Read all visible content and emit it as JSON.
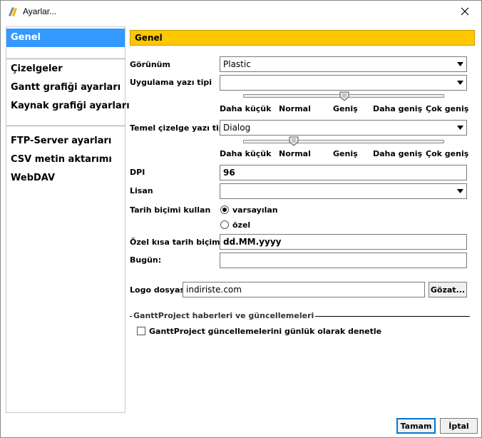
{
  "window": {
    "title": "Ayarlar...",
    "icon": "ganttproject-app-icon",
    "close_icon": "close-icon"
  },
  "nav": {
    "items": [
      {
        "label": "Genel",
        "selected": true
      },
      {
        "label": "Çizelgeler",
        "group": true
      },
      {
        "label": "Gantt grafiği ayarları"
      },
      {
        "label": "Kaynak grafiği ayarları"
      },
      {
        "label": "FTP-Server ayarları"
      },
      {
        "label": "CSV metin aktarımı"
      },
      {
        "label": "WebDAV"
      }
    ]
  },
  "section": {
    "title": "Genel"
  },
  "form": {
    "appearance_label": "Görünüm",
    "appearance_value": "Plastic",
    "app_font_label": "Uygulama yazı tipi",
    "app_font_value": "",
    "app_font_slider_value": "Geniş",
    "chart_font_label": "Temel çizelge yazı tipi",
    "chart_font_value": "Dialog",
    "chart_font_slider_value": "Normal",
    "size_ticks": [
      "Daha küçük",
      "Normal",
      "Geniş",
      "Daha geniş",
      "Çok geniş"
    ],
    "dpi_label": "DPI",
    "dpi_value": "96",
    "language_label": "Lisan",
    "language_value": "",
    "date_format_label": "Tarih biçimi kullan",
    "date_format_options": [
      {
        "label": "varsayılan",
        "selected": true
      },
      {
        "label": "özel",
        "selected": false
      }
    ],
    "custom_date_label": "Özel kısa tarih biçimi",
    "custom_date_value": "dd.MM.yyyy",
    "today_label": "Bugün:",
    "today_value": "",
    "logo_label": "Logo dosyası",
    "logo_value": "indiriste.com",
    "browse_label": "Gözat..."
  },
  "updates": {
    "group_title": "GanttProject haberleri ve güncellemeleri",
    "check_label": "GanttProject güncellemelerini günlük olarak denetle",
    "checked": false
  },
  "footer": {
    "ok_label": "Tamam",
    "cancel_label": "İptal"
  },
  "colors": {
    "selection": "#3399ff",
    "section_header": "#ffc700"
  }
}
